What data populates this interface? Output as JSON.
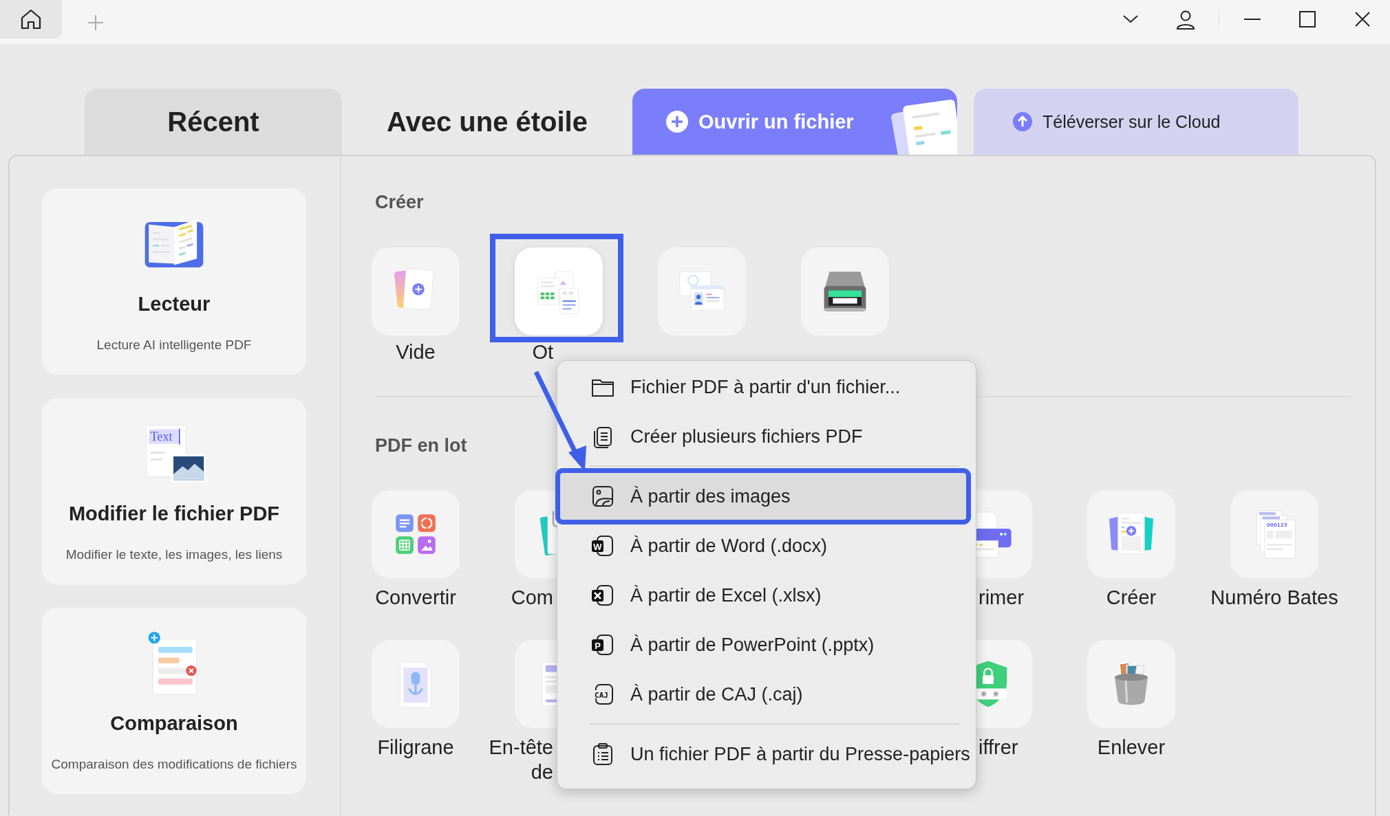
{
  "titlebar": {
    "home": true
  },
  "tabs": [
    {
      "label": "Récent",
      "selected": true
    },
    {
      "label": "Avec une étoile",
      "selected": false
    }
  ],
  "actions": [
    {
      "kind": "primary",
      "label": "Ouvrir un fichier"
    },
    {
      "kind": "secondary",
      "label": "Téléverser sur le Cloud"
    }
  ],
  "side_cards": [
    {
      "title": "Lecteur",
      "subtitle": "Lecture AI intelligente PDF"
    },
    {
      "title": "Modifier le fichier PDF",
      "subtitle": "Modifier le texte, les images, les liens",
      "icon_text": "Text"
    },
    {
      "title": "Comparaison",
      "subtitle": "Comparaison des modifications de fichiers"
    }
  ],
  "create": {
    "title": "Créer",
    "tiles": [
      {
        "label": "Vide",
        "selected": false
      },
      {
        "label": "Ot",
        "selected": true
      },
      {
        "selected": false
      },
      {
        "selected": false
      }
    ]
  },
  "batch": {
    "title": "PDF en lot",
    "rows": [
      [
        {
          "label": "Convertir"
        },
        {
          "label": "Com"
        },
        {
          "label": "rimer"
        },
        {
          "label": "Créer"
        },
        {
          "label": "Numéro Bates",
          "icon_text": "000123"
        }
      ],
      [
        {
          "label": "Filigrane"
        },
        {
          "label": "En-tête\nde"
        },
        {
          "label": "iffrer"
        },
        {
          "label": "Enlever"
        }
      ]
    ]
  },
  "menu": [
    {
      "kind": "folder",
      "label": "Fichier PDF à partir d'un fichier...",
      "selected": false
    },
    {
      "kind": "copies",
      "label": "Créer plusieurs fichiers PDF",
      "selected": false
    },
    {
      "kind": "separator"
    },
    {
      "kind": "image",
      "label": "À partir des images",
      "selected": true
    },
    {
      "kind": "word",
      "label": "À partir de Word (.docx)",
      "icon_text": "W",
      "selected": false
    },
    {
      "kind": "excel",
      "label": "À partir de Excel (.xlsx)",
      "selected": false
    },
    {
      "kind": "powerpoint",
      "label": "À partir de PowerPoint (.pptx)",
      "icon_text": "P",
      "selected": false
    },
    {
      "kind": "caj",
      "label": "À partir de CAJ (.caj)",
      "icon_text": "CAJ",
      "selected": false
    },
    {
      "kind": "separator"
    },
    {
      "kind": "clipboard",
      "label": "Un fichier PDF à partir du Presse-papiers",
      "selected": false
    }
  ]
}
